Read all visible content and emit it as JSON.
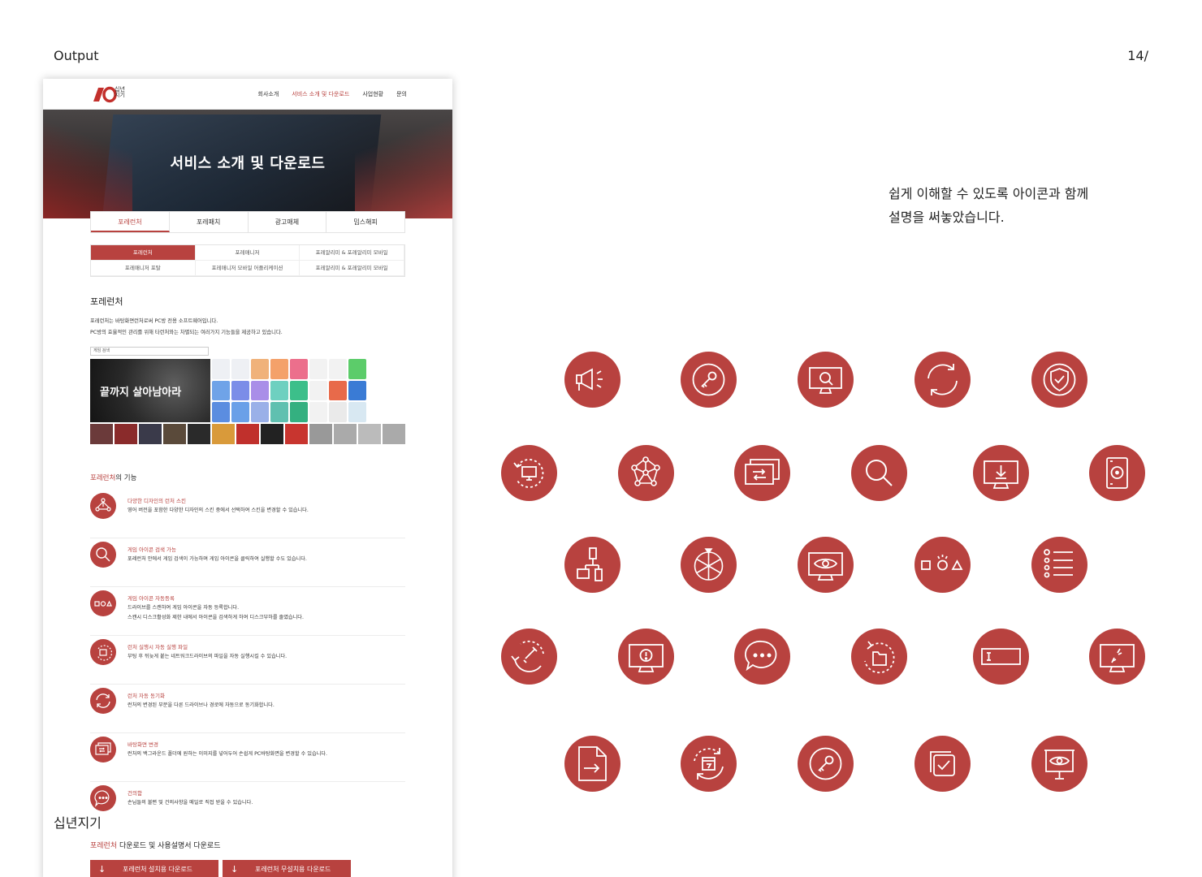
{
  "header": {
    "label": "Output",
    "page_number": "14/"
  },
  "footer": {
    "label": "십년지기"
  },
  "description": {
    "line1": "쉽게 이해할 수 있도록 아이콘과 함께",
    "line2": "설명을 써놓았습니다."
  },
  "mockup": {
    "logo_text": "십년\n지기",
    "nav": [
      "회사소개",
      "서비스 소개 및 다운로드",
      "사업현황",
      "문의"
    ],
    "hero_title": "서비스 소개 및 다운로드",
    "tabs": [
      "포레런처",
      "포레패치",
      "광고매체",
      "밈스해피"
    ],
    "subtabs": [
      "포레런처",
      "포레매니저",
      "포레알리미 & 포레알리미 모바일",
      "포레매니저 포탈",
      "포레매니저 모바일 어플리케이션",
      "포레알리미 & 포레알리미 모바일"
    ],
    "section_title": "포레런처",
    "section_desc1": "포레런처는 바탕화면런처로써 PC방 전용 소프트웨어입니다.",
    "section_desc2": "PC방의 효율적인 관리를 위해 타런처와는 차별되는 여러가지 기능들을 제공하고 있습니다.",
    "search_placeholder": "게임 검색",
    "banner_text": "끝까지 살아남아라",
    "features_title_accent": "포레런처",
    "features_title_rest": "의 기능",
    "features": [
      {
        "title": "다양한 디자인의 런처 스킨",
        "desc": "영어 버전을 포함한 다양한 디자인의 스킨 중에서 선택하여 스킨을 변경할 수 있습니다."
      },
      {
        "title": "게임 아이콘 검색 가능",
        "desc": "포레런처 안에서 게임 검색이 가능하며 게임 아이콘을 클릭하여 실행할 수도 있습니다."
      },
      {
        "title": "게임 아이콘 자동등록",
        "desc": "드라이브를 스캔하여 게임 아이콘을 자동 등록합니다.\n스캔시 디스크활성화 제한 내에서 아이콘을 검색하게 하여 디스크부하를 줄였습니다."
      },
      {
        "title": "런처 실행시 자동 실행 파일",
        "desc": "부팅 후 뒤늦게 붙는 네트워크드라이브의 파일을 자동 실행시킬 수 있습니다."
      },
      {
        "title": "런처 자동 동기화",
        "desc": "런처의 변경된 부분을 다른 드라이브나 경로에 자동으로 동기화합니다."
      },
      {
        "title": "바탕화면 변경",
        "desc": "런처의 백그라운드 폴더에 원하는 이미지를 넣어두어 손쉽게 PC바탕화면을 변경할 수 있습니다."
      },
      {
        "title": "건의함",
        "desc": "손님들의 불편 및 건의사항을 메일로 직접 받을 수 있습니다."
      }
    ],
    "download_title_accent": "포레런처",
    "download_title_rest": " 다운로드 및 사용설명서 다운로드",
    "download_buttons": [
      "포레런처 설치용 다운로드",
      "포레런처 무설치용 다운로드"
    ]
  },
  "icons": [
    "megaphone-icon",
    "key-icon",
    "monitor-search-icon",
    "sync-icon",
    "shield-check-icon",
    "monitor-rotate-icon",
    "network-node-icon",
    "screen-swap-icon",
    "search-icon",
    "monitor-download-icon",
    "disk-icon",
    "flowchart-icon",
    "color-wheel-icon",
    "monitor-eye-icon",
    "shapes-icon",
    "list-settings-icon",
    "rotate-tool-icon",
    "monitor-alert-icon",
    "chat-icon",
    "folder-rotate-icon",
    "text-field-icon",
    "monitor-link-icon",
    "file-export-icon",
    "calendar-sync-icon",
    "key-circle-icon",
    "checkbox-stack-icon",
    "presentation-eye-icon"
  ],
  "colors": {
    "accent": "#b8423f"
  }
}
